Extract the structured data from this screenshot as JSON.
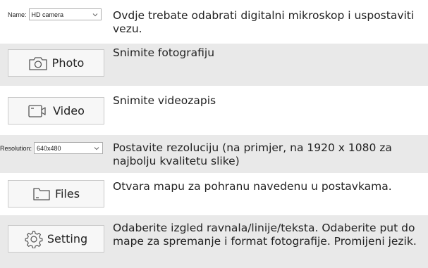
{
  "name_select": {
    "label": "Name:",
    "value": "HD camera",
    "description": "Ovdje trebate odabrati digitalni mikroskop i uspostaviti vezu."
  },
  "photo": {
    "label": "Photo",
    "icon": "camera-icon",
    "description": "Snimite fotografiju"
  },
  "video": {
    "label": "Video",
    "icon": "video-camera-icon",
    "description": "Snimite videozapis"
  },
  "resolution_select": {
    "label": "Resolution:",
    "value": "640x480",
    "description": "Postavite rezoluciju (na primjer, na 1920 x 1080 za najbolju kvalitetu slike)"
  },
  "files": {
    "label": "Files",
    "icon": "folder-icon",
    "description": "Otvara mapu za pohranu navedenu u postavkama."
  },
  "setting": {
    "label": "Setting",
    "icon": "gear-icon",
    "description": "Odaberite izgled ravnala/linije/teksta. Odaberite put do mape za spremanje i format fotografije. Promijeni jezik."
  },
  "colors": {
    "row_shade": "#e9e9e9",
    "button_bg": "#f7f7f7",
    "button_border": "#c9c9c9"
  }
}
